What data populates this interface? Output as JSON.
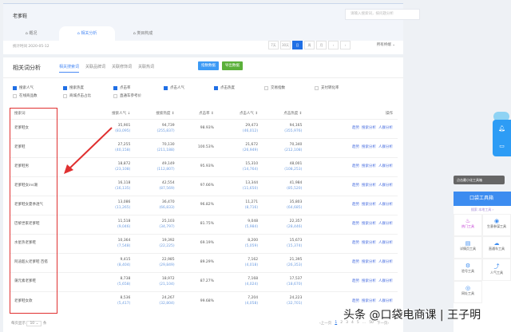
{
  "header": {
    "keyword": "老爹鞋",
    "search_placeholder": "请输入搜索词，按问题分析",
    "tabs": [
      "概况",
      "相关分析",
      "类目构成"
    ],
    "active_tab": 1,
    "date_label": "统计时间 2020-05-12",
    "date_buttons": [
      "7天",
      "30天",
      "日",
      "周",
      "月",
      "‹",
      "›"
    ],
    "active_date": "日",
    "category": "所有终端 ⌄"
  },
  "section": {
    "title": "相关词分析",
    "subtabs": [
      "相关搜索词",
      "关联品牌词",
      "关联修饰词",
      "关联热词"
    ],
    "btn_index": "指数数据",
    "btn_export": "导出数据"
  },
  "checks": [
    {
      "label": "搜索人气",
      "on": true
    },
    {
      "label": "搜索热度",
      "on": true
    },
    {
      "label": "点击率",
      "on": true
    },
    {
      "label": "点击人气",
      "on": true
    },
    {
      "label": "点击热度",
      "on": true
    },
    {
      "label": "交易指数",
      "on": false
    },
    {
      "label": "支付转化率",
      "on": false
    },
    {
      "label": "在线商品数",
      "on": false
    },
    {
      "label": "商城点击占比",
      "on": false
    },
    {
      "label": "直通车参考价",
      "on": false
    }
  ],
  "columns": [
    "搜索词",
    "搜索人气 ↓",
    "搜索热度 ↕",
    "点击率 ↕",
    "点击人气 ↕",
    "点击热度 ↕",
    "操作"
  ],
  "actions": [
    "趋势",
    "搜索分析",
    "人群分析"
  ],
  "rows": [
    [
      "老爹鞋女",
      "35,901",
      "(83,095)",
      "94,739",
      "(255,837)",
      "98.93%",
      "29,473",
      "(46,012)",
      "94,165",
      "(355,976)"
    ],
    [
      "老爹鞋",
      "27,255",
      "(40,158)",
      "70,130",
      "(211,188)",
      "100.53%",
      "21,672",
      "(26,949)",
      "70,340",
      "(212,108)"
    ],
    [
      "老爹鞋男",
      "18,872",
      "(23,108)",
      "49,149",
      "(112,807)",
      "95.93%",
      "15,310",
      "(14,764)",
      "48,001",
      "(108,253)"
    ],
    [
      "老爹鞋女ins潮",
      "16,118",
      "(16,135)",
      "42,554",
      "(87,569)",
      "97.66%",
      "13,344",
      "(11,650)",
      "41,984",
      "(85,520)"
    ],
    [
      "老爹鞋女夏季透气",
      "13,086",
      "(11,265)",
      "36,470",
      "(66,833)",
      "96.82%",
      "11,271",
      "(8,716)",
      "35,803",
      "(64,685)"
    ],
    [
      "巴黎世家老爹鞋",
      "11,518",
      "(9,046)",
      "25,103",
      "(34,797)",
      "81.75%",
      "9,048",
      "(5,984)",
      "22,357",
      "(28,446)"
    ],
    [
      "水星热老爹鞋",
      "10,364",
      "(7,548)",
      "19,392",
      "(22,225)",
      "69.19%",
      "8,200",
      "(5,059)",
      "15,673",
      "(15,374)"
    ],
    [
      "阿迪超火老爹鞋 百搭",
      "9,415",
      "(8,404)",
      "22,985",
      "(29,849)",
      "89.29%",
      "7,162",
      "(4,018)",
      "21,395",
      "(26,353)"
    ],
    [
      "蒲元素老爹鞋",
      "8,738",
      "(5,658)",
      "18,972",
      "(21,104)",
      "87.27%",
      "7,168",
      "(4,024)",
      "17,537",
      "(18,670)"
    ],
    [
      "老爹鞋女款",
      "8,536",
      "(5,417)",
      "24,267",
      "(32,804)",
      "99.68%",
      "7,204",
      "(4,058)",
      "24,223",
      "(32,701)"
    ]
  ],
  "footer": {
    "per_page_label": "每页显示",
    "per_page": "10 ⌄",
    "unit": "条",
    "pages": [
      "‹上一页",
      "1",
      "2",
      "3",
      "4",
      "5",
      "…",
      "50",
      "下一页›"
    ]
  },
  "watermark": "头条 @口袋电商课 | 王子明",
  "toolbox": {
    "tooltip": "点击最小化工具箱",
    "title": "口袋工具箱",
    "search": "搜索 本地工具 ›",
    "tools": [
      "热门工具",
      "生意参谋工具",
      "详情页工具",
      "直通车工具",
      "验号工具",
      "人气工具",
      "网址工具"
    ]
  },
  "colors": {
    "accent": "#1f6fe5",
    "export": "#5bb03a",
    "highlight": "#e03030"
  }
}
